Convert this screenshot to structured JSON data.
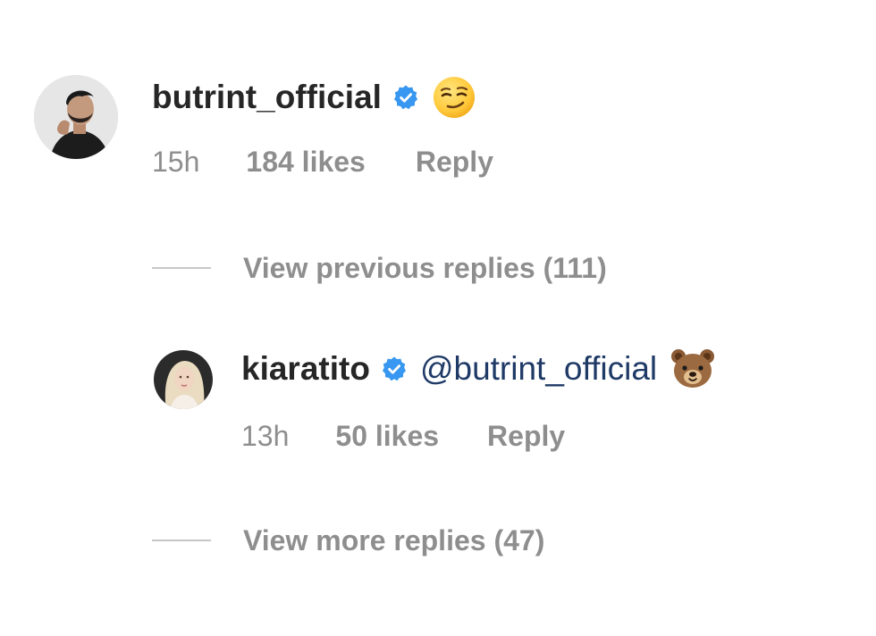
{
  "colors": {
    "text_primary": "#262626",
    "text_secondary": "#8e8e8e",
    "verified_blue": "#3897f0",
    "mention": "#1f3a66",
    "divider": "#c7c7c7"
  },
  "comment": {
    "username": "butrint_official",
    "verified": true,
    "emoji": "smirking-face",
    "time": "15h",
    "likes": "184 likes",
    "reply_label": "Reply"
  },
  "view_previous": {
    "label": "View previous replies (111)"
  },
  "reply": {
    "username": "kiaratito",
    "verified": true,
    "mention_text": "@butrint_official",
    "emoji": "bear-face",
    "time": "13h",
    "likes": "50 likes",
    "reply_label": "Reply"
  },
  "view_more": {
    "label": "View more replies (47)"
  }
}
